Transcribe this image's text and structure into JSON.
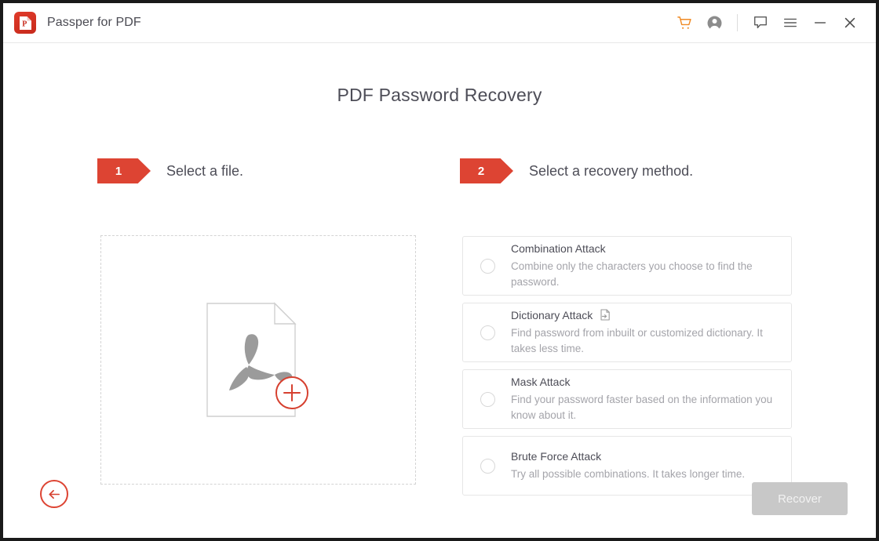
{
  "window": {
    "app_title": "Passper for PDF",
    "logo_icon": "pdf-app-logo-icon",
    "accent_color": "#dd4433",
    "cart_color": "#f08a24"
  },
  "titlebar": {
    "buttons": [
      {
        "name": "cart-icon",
        "label": "Cart"
      },
      {
        "name": "account-icon",
        "label": "Account"
      },
      {
        "name": "feedback-icon",
        "label": "Feedback"
      },
      {
        "name": "menu-icon",
        "label": "Menu"
      },
      {
        "name": "minimize-icon",
        "label": "Minimize"
      },
      {
        "name": "close-icon",
        "label": "Close"
      }
    ]
  },
  "main": {
    "page_title": "PDF Password Recovery",
    "steps": [
      {
        "number": "1",
        "label": "Select a file."
      },
      {
        "number": "2",
        "label": "Select a recovery method."
      }
    ],
    "dropzone": {
      "icon": "pdf-file-add-icon",
      "add_badge": "plus-icon"
    },
    "methods": [
      {
        "name": "Combination Attack",
        "description": "Combine only the characters you choose to find the password.",
        "selected": false,
        "has_import_icon": false
      },
      {
        "name": "Dictionary Attack",
        "description": "Find password from inbuilt or customized dictionary. It takes less time.",
        "selected": false,
        "has_import_icon": true,
        "import_icon": "import-dictionary-icon"
      },
      {
        "name": "Mask Attack",
        "description": "Find your password faster based on the information you know about it.",
        "selected": false,
        "has_import_icon": false
      },
      {
        "name": "Brute Force Attack",
        "description": "Try all possible combinations. It takes longer time.",
        "selected": false,
        "has_import_icon": false
      }
    ]
  },
  "footer": {
    "back_label": "Back",
    "back_icon": "arrow-left-icon",
    "recover_label": "Recover",
    "recover_enabled": false
  }
}
